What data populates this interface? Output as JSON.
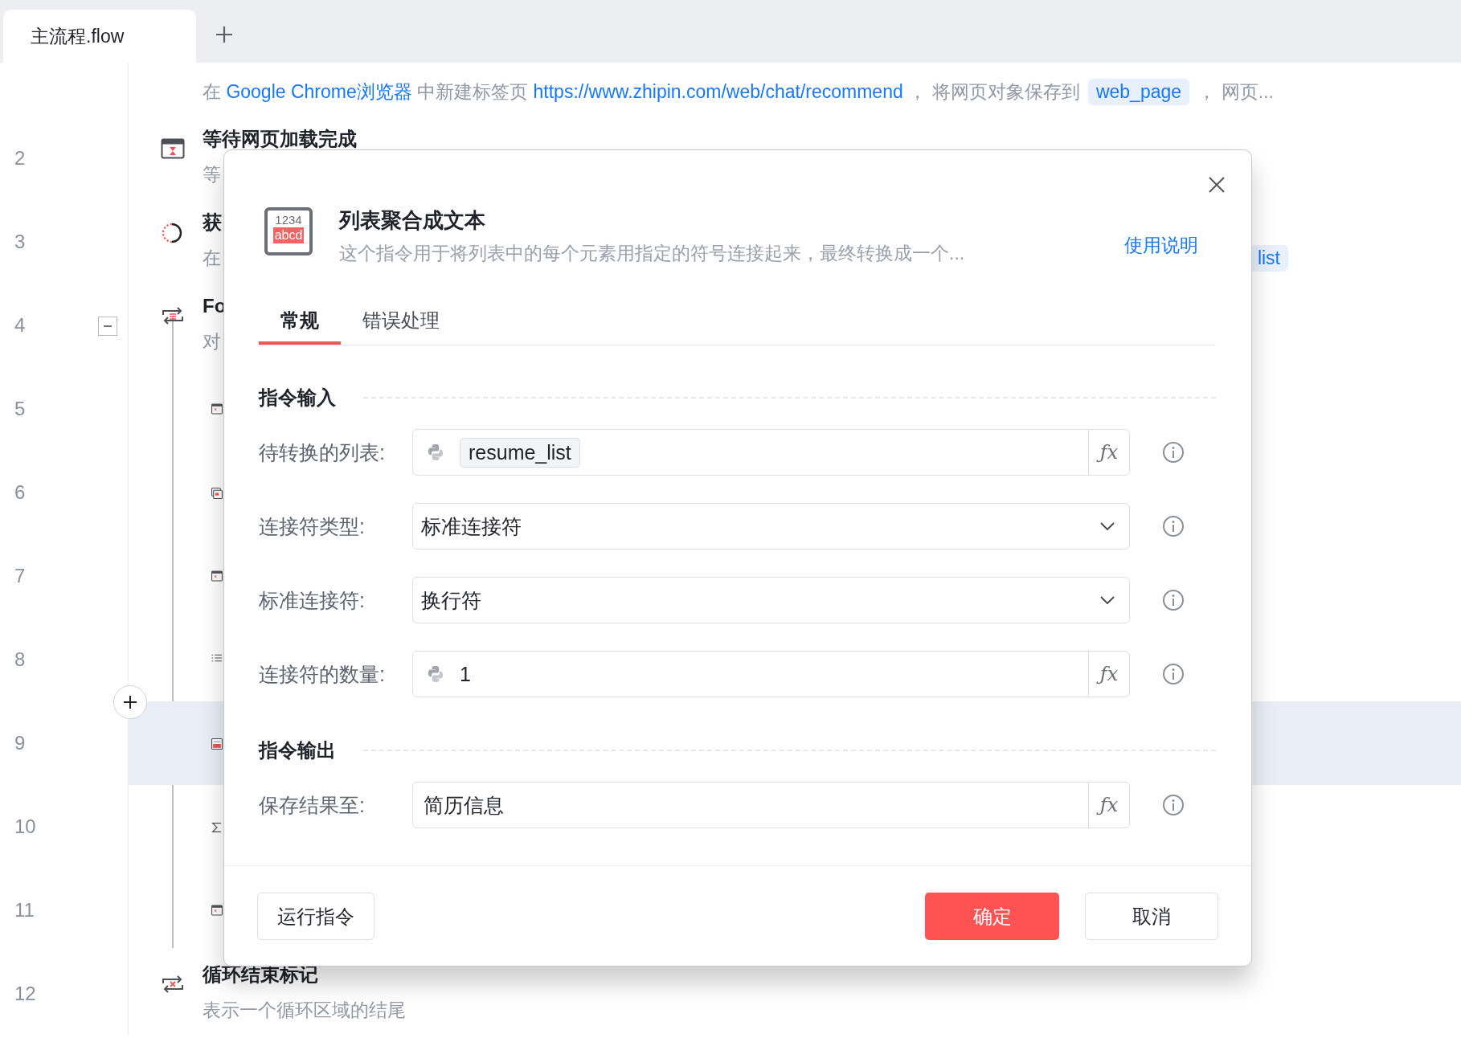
{
  "tabs": [
    {
      "label": "主流程.flow",
      "selected": true
    }
  ],
  "flow": {
    "rows": [
      {
        "selected": false,
        "description": [
          {
            "kind": "text",
            "text": "在 "
          },
          {
            "kind": "link",
            "text": "Google Chrome浏览器"
          },
          {
            "kind": "text",
            "text": " 中新建标签页 "
          },
          {
            "kind": "link",
            "text": "https://www.zhipin.com/web/chat/recommend"
          },
          {
            "kind": "text",
            "text": " ， 将网页对象保存到 "
          },
          {
            "kind": "var",
            "text": "web_page"
          },
          {
            "kind": "text",
            "text": " ， 网页..."
          }
        ]
      },
      {
        "line": "2",
        "selected": false,
        "title": "等待网页加载完成",
        "description": [
          {
            "kind": "text",
            "text": "等"
          }
        ]
      },
      {
        "line": "3",
        "selected": false,
        "title": "获",
        "description": [
          {
            "kind": "text",
            "text": "在"
          }
        ],
        "description_end": [
          {
            "kind": "var",
            "text": "list"
          }
        ]
      },
      {
        "line": "4",
        "selected": false,
        "expanded": true,
        "title": "Fo",
        "description": [
          {
            "kind": "text",
            "text": "对"
          }
        ],
        "children": [
          {
            "line": "5",
            "selected": false
          },
          {
            "line": "6",
            "selected": false
          },
          {
            "line": "7",
            "selected": false
          },
          {
            "line": "8",
            "selected": false
          },
          {
            "line": "9",
            "selected": true
          },
          {
            "line": "10",
            "selected": false
          },
          {
            "line": "11",
            "selected": false
          }
        ]
      },
      {
        "line": "12",
        "selected": false,
        "title": "循环结束标记",
        "description": [
          {
            "kind": "text",
            "text": "表示一个循环区域的结尾"
          }
        ]
      }
    ]
  },
  "dialog": {
    "icon_lines": [
      "1234",
      "abcd"
    ],
    "title": "列表聚合成文本",
    "description": "这个指令用于将列表中的每个元素用指定的符号连接起来，最终转换成一个...",
    "help_link": "使用说明",
    "tabs": [
      {
        "label": "常规",
        "selected": true
      },
      {
        "label": "错误处理",
        "selected": false
      }
    ],
    "sections": [
      {
        "title": "指令输入",
        "fields": [
          {
            "label": "待转换的列表:",
            "kind": "variable",
            "value": "resume_list",
            "fx": "ƒx"
          },
          {
            "label": "连接符类型:",
            "kind": "select",
            "value": "标准连接符"
          },
          {
            "label": "标准连接符:",
            "kind": "select",
            "value": "换行符"
          },
          {
            "label": "连接符的数量:",
            "kind": "python",
            "value": "1",
            "fx": "ƒx"
          }
        ]
      },
      {
        "title": "指令输出",
        "fields": [
          {
            "label": "保存结果至:",
            "kind": "text",
            "value": "简历信息",
            "fx": "ƒx"
          }
        ]
      }
    ],
    "buttons": [
      {
        "label": "运行指令",
        "kind": "default"
      },
      {
        "label": "确定",
        "kind": "primary"
      },
      {
        "label": "取消",
        "kind": "default"
      }
    ]
  }
}
